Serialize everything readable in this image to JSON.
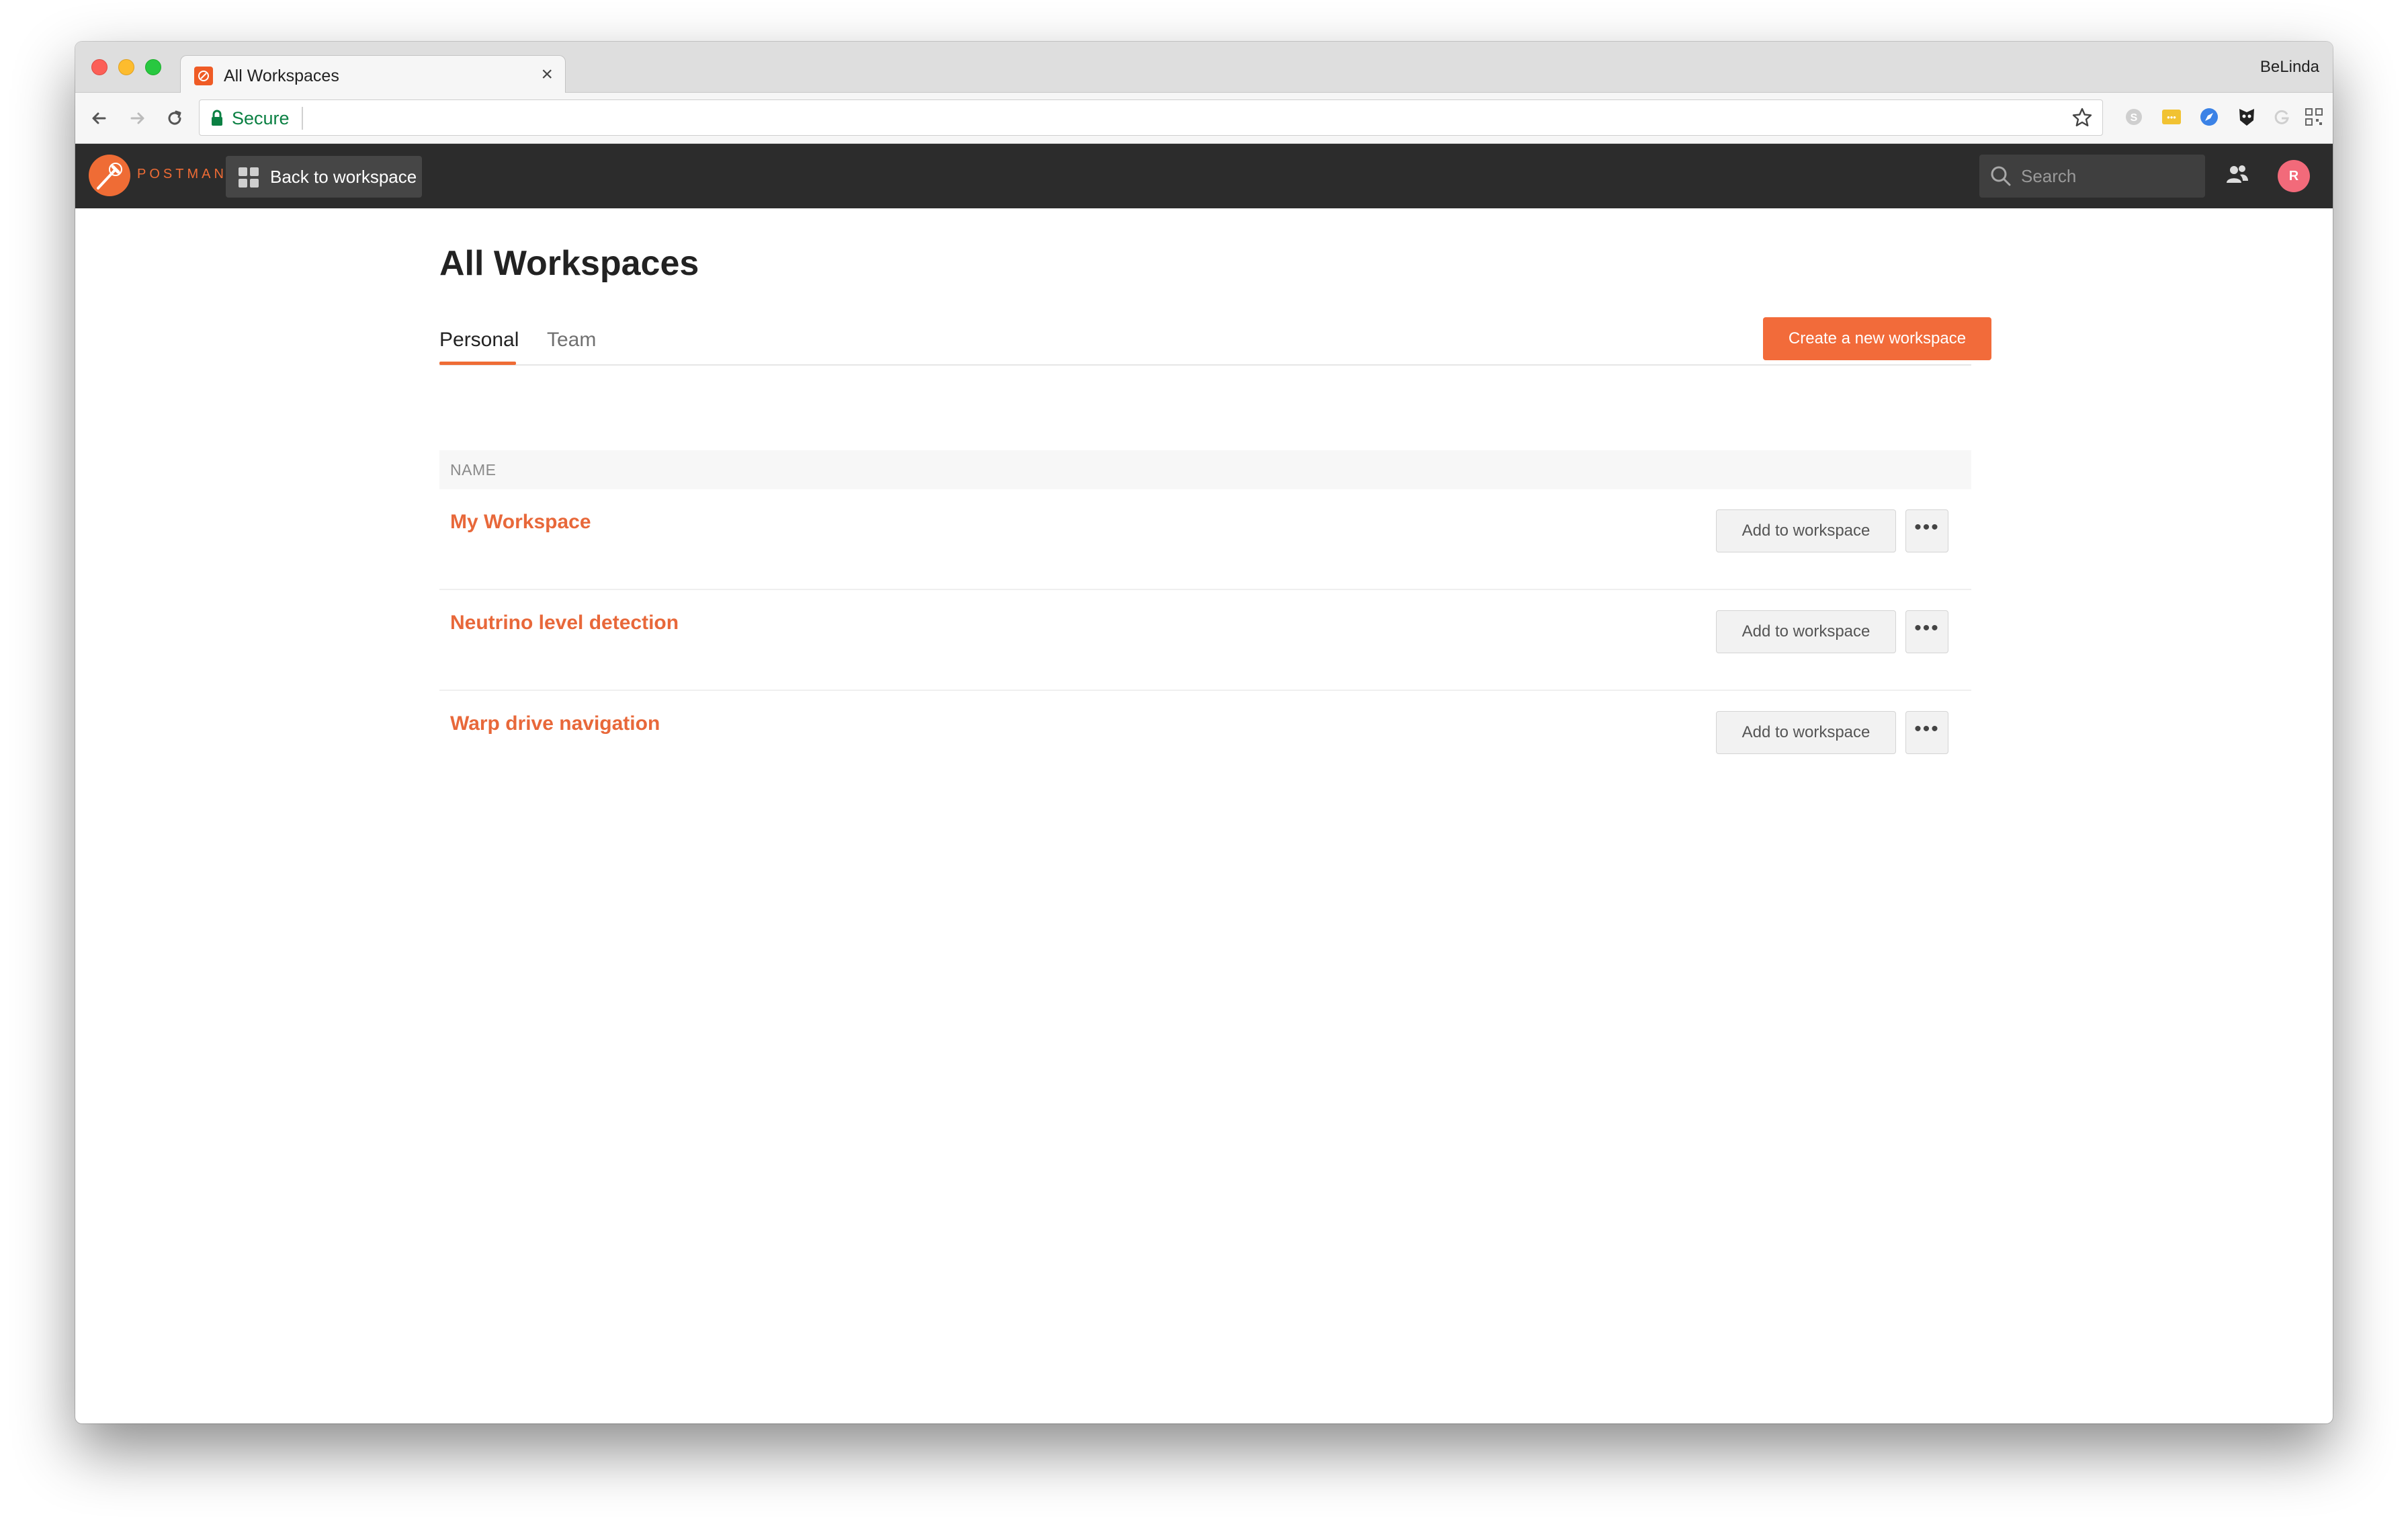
{
  "browser": {
    "tab_title": "All Workspaces",
    "tab_close": "×",
    "profile_name": "BeLinda",
    "secure_label": "Secure"
  },
  "app": {
    "logo_text": "POSTMAN",
    "back_button_label": "Back to workspace",
    "search_placeholder": "Search",
    "avatar_initial": "R",
    "brand_color": "#f26b3a"
  },
  "page": {
    "title": "All Workspaces",
    "tabs": [
      {
        "label": "Personal",
        "active": true
      },
      {
        "label": "Team",
        "active": false
      }
    ],
    "create_button_label": "Create a new workspace",
    "table_header": "NAME",
    "workspaces": [
      {
        "name": "My Workspace",
        "action_label": "Add to workspace",
        "more_label": "•••"
      },
      {
        "name": "Neutrino level detection",
        "action_label": "Add to workspace",
        "more_label": "•••"
      },
      {
        "name": "Warp drive navigation",
        "action_label": "Add to workspace",
        "more_label": "•••"
      }
    ]
  }
}
